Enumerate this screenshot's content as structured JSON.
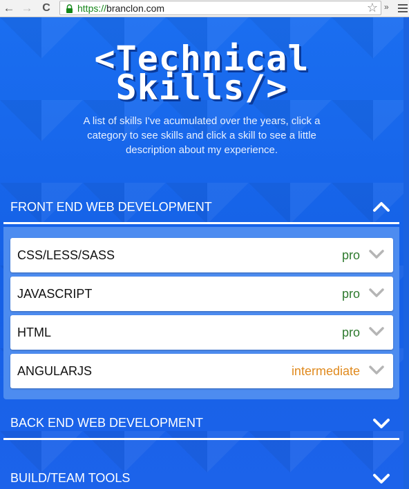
{
  "browser": {
    "back_glyph": "←",
    "forward_glyph": "→",
    "reload_glyph": "C",
    "url_scheme": "https://",
    "url_host": "branclon.com",
    "star_glyph": "☆",
    "extensions_glyph": "»"
  },
  "header": {
    "title_line1": "<Technical",
    "title_line2": "Skills/>",
    "intro": "A list of skills I've acumulated over the years, click a category to see skills and click a skill to see a little description about my experience."
  },
  "categories": [
    {
      "label": "FRONT END WEB DEVELOPMENT",
      "expanded": true,
      "skills": [
        {
          "name": "CSS/LESS/SASS",
          "level": "pro"
        },
        {
          "name": "JAVASCRIPT",
          "level": "pro"
        },
        {
          "name": "HTML",
          "level": "pro"
        },
        {
          "name": "ANGULARJS",
          "level": "intermediate"
        }
      ]
    },
    {
      "label": "BACK END WEB DEVELOPMENT",
      "expanded": false
    },
    {
      "label": "BUILD/TEAM TOOLS",
      "expanded": false
    }
  ],
  "colors": {
    "background": "#1560e6",
    "level_pro": "#2e7a2e",
    "level_intermediate": "#e08a1e"
  }
}
